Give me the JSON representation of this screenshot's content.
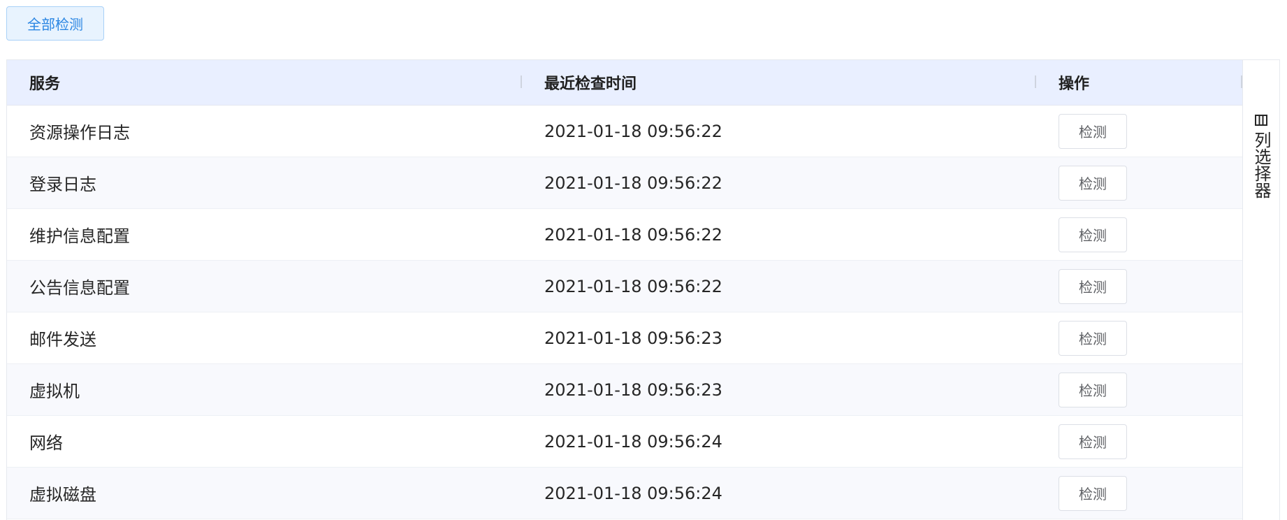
{
  "toolbar": {
    "check_all_label": "全部检测"
  },
  "table": {
    "columns": [
      "服务",
      "最近检查时间",
      "操作"
    ],
    "rows": [
      {
        "service": "资源操作日志",
        "time": "2021-01-18 09:56:22",
        "action": "检测"
      },
      {
        "service": "登录日志",
        "time": "2021-01-18 09:56:22",
        "action": "检测"
      },
      {
        "service": "维护信息配置",
        "time": "2021-01-18 09:56:22",
        "action": "检测"
      },
      {
        "service": "公告信息配置",
        "time": "2021-01-18 09:56:22",
        "action": "检测"
      },
      {
        "service": "邮件发送",
        "time": "2021-01-18 09:56:23",
        "action": "检测"
      },
      {
        "service": "虚拟机",
        "time": "2021-01-18 09:56:23",
        "action": "检测"
      },
      {
        "service": "网络",
        "time": "2021-01-18 09:56:24",
        "action": "检测"
      },
      {
        "service": "虚拟磁盘",
        "time": "2021-01-18 09:56:24",
        "action": "检测"
      }
    ]
  },
  "column_selector": {
    "icon": "columns-icon",
    "label": "列选择器"
  },
  "colors": {
    "accent": "#2b86e3",
    "header_bg": "#e9efff",
    "row_alt_bg": "#f8f9fd"
  }
}
